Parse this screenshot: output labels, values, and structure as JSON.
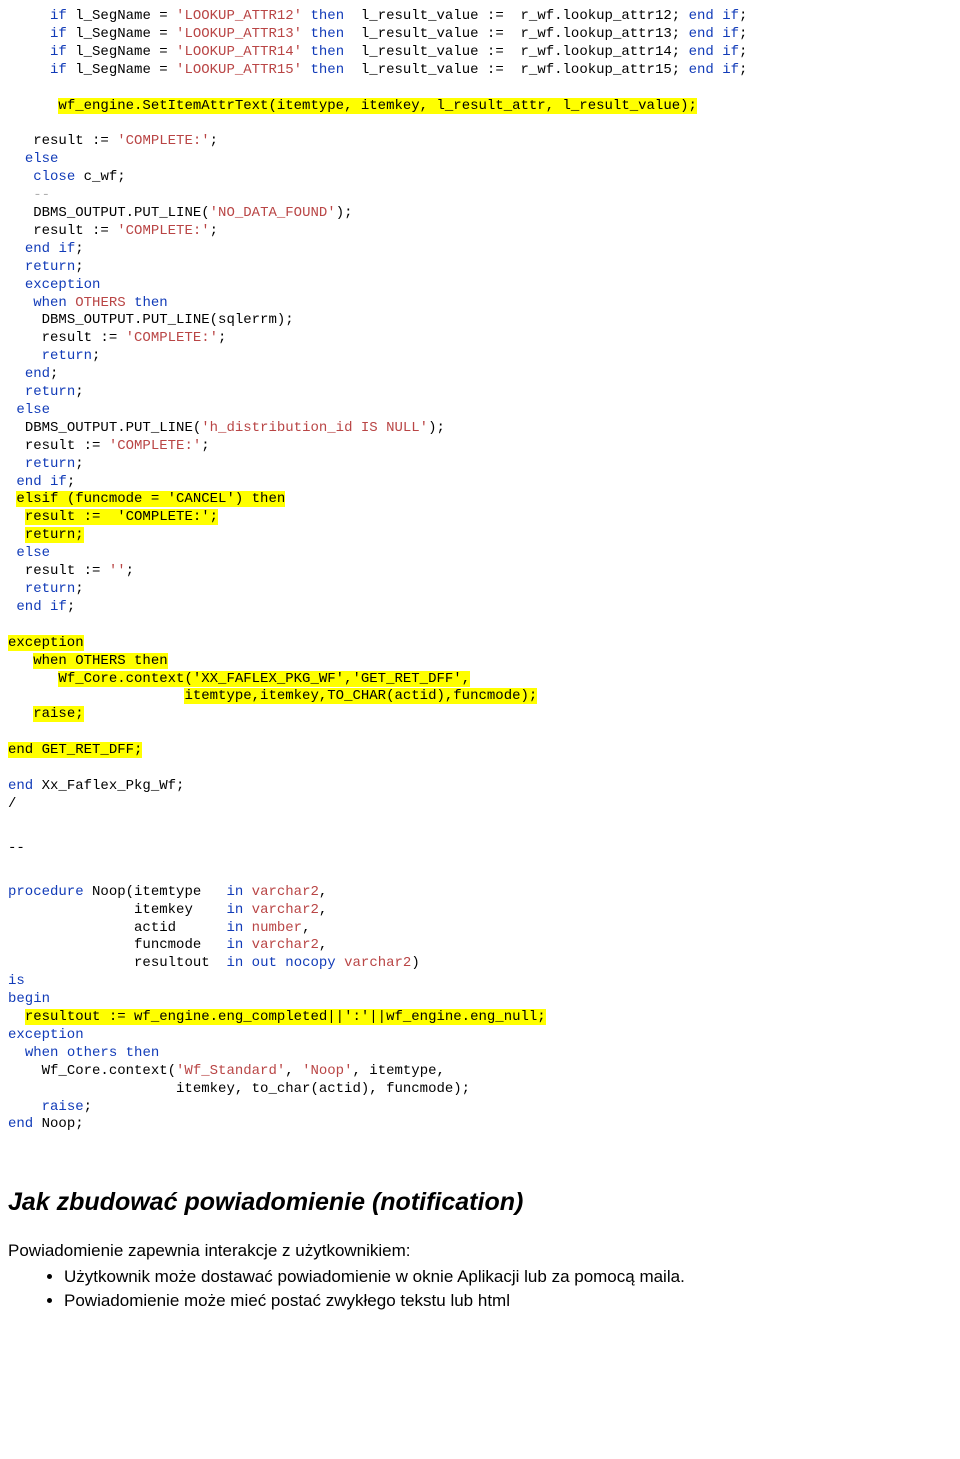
{
  "code1": [
    {
      "indent": "     ",
      "segments": [
        {
          "t": "if",
          "c": "kw"
        },
        {
          "t": " l_SegName = "
        },
        {
          "t": "'LOOKUP_ATTR12'",
          "c": "str"
        },
        {
          "t": " "
        },
        {
          "t": "then",
          "c": "kw"
        },
        {
          "t": "  l_result_value :=  r_wf.lookup_attr12; "
        },
        {
          "t": "end",
          "c": "kw"
        },
        {
          "t": " "
        },
        {
          "t": "if",
          "c": "kw"
        },
        {
          "t": ";"
        }
      ]
    },
    {
      "indent": "     ",
      "segments": [
        {
          "t": "if",
          "c": "kw"
        },
        {
          "t": " l_SegName = "
        },
        {
          "t": "'LOOKUP_ATTR13'",
          "c": "str"
        },
        {
          "t": " "
        },
        {
          "t": "then",
          "c": "kw"
        },
        {
          "t": "  l_result_value :=  r_wf.lookup_attr13; "
        },
        {
          "t": "end",
          "c": "kw"
        },
        {
          "t": " "
        },
        {
          "t": "if",
          "c": "kw"
        },
        {
          "t": ";"
        }
      ]
    },
    {
      "indent": "     ",
      "segments": [
        {
          "t": "if",
          "c": "kw"
        },
        {
          "t": " l_SegName = "
        },
        {
          "t": "'LOOKUP_ATTR14'",
          "c": "str"
        },
        {
          "t": " "
        },
        {
          "t": "then",
          "c": "kw"
        },
        {
          "t": "  l_result_value :=  r_wf.lookup_attr14; "
        },
        {
          "t": "end",
          "c": "kw"
        },
        {
          "t": " "
        },
        {
          "t": "if",
          "c": "kw"
        },
        {
          "t": ";"
        }
      ]
    },
    {
      "indent": "     ",
      "segments": [
        {
          "t": "if",
          "c": "kw"
        },
        {
          "t": " l_SegName = "
        },
        {
          "t": "'LOOKUP_ATTR15'",
          "c": "str"
        },
        {
          "t": " "
        },
        {
          "t": "then",
          "c": "kw"
        },
        {
          "t": "  l_result_value :=  r_wf.lookup_attr15; "
        },
        {
          "t": "end",
          "c": "kw"
        },
        {
          "t": " "
        },
        {
          "t": "if",
          "c": "kw"
        },
        {
          "t": ";"
        }
      ]
    },
    {
      "indent": "",
      "segments": [
        {
          "t": " "
        }
      ]
    },
    {
      "indent": "      ",
      "segments": [
        {
          "t": "wf_engine.SetItemAttrText(itemtype, itemkey, l_result_attr, l_result_value);",
          "c": "hl"
        }
      ]
    },
    {
      "indent": "",
      "segments": [
        {
          "t": " "
        }
      ]
    },
    {
      "indent": "   ",
      "segments": [
        {
          "t": "result := "
        },
        {
          "t": "'COMPLETE:'",
          "c": "str"
        },
        {
          "t": ";"
        }
      ]
    },
    {
      "indent": "  ",
      "segments": [
        {
          "t": "else",
          "c": "kw"
        }
      ]
    },
    {
      "indent": "   ",
      "segments": [
        {
          "t": "close",
          "c": "kw"
        },
        {
          "t": " c_wf;"
        }
      ]
    },
    {
      "indent": "   ",
      "segments": [
        {
          "t": "--",
          "c": "gray"
        }
      ]
    },
    {
      "indent": "   ",
      "segments": [
        {
          "t": "DBMS_OUTPUT.PUT_LINE("
        },
        {
          "t": "'NO_DATA_FOUND'",
          "c": "str"
        },
        {
          "t": ");"
        }
      ]
    },
    {
      "indent": "   ",
      "segments": [
        {
          "t": "result := "
        },
        {
          "t": "'COMPLETE:'",
          "c": "str"
        },
        {
          "t": ";"
        }
      ]
    },
    {
      "indent": "  ",
      "segments": [
        {
          "t": "end",
          "c": "kw"
        },
        {
          "t": " "
        },
        {
          "t": "if",
          "c": "kw"
        },
        {
          "t": ";"
        }
      ]
    },
    {
      "indent": "  ",
      "segments": [
        {
          "t": "return",
          "c": "kw"
        },
        {
          "t": ";"
        }
      ]
    },
    {
      "indent": "  ",
      "segments": [
        {
          "t": "exception",
          "c": "kw"
        }
      ]
    },
    {
      "indent": "   ",
      "segments": [
        {
          "t": "when",
          "c": "kw"
        },
        {
          "t": " "
        },
        {
          "t": "OTHERS",
          "c": "str"
        },
        {
          "t": " "
        },
        {
          "t": "then",
          "c": "kw"
        }
      ]
    },
    {
      "indent": "    ",
      "segments": [
        {
          "t": "DBMS_OUTPUT.PUT_LINE(sqlerrm);"
        }
      ]
    },
    {
      "indent": "    ",
      "segments": [
        {
          "t": "result := "
        },
        {
          "t": "'COMPLETE:'",
          "c": "str"
        },
        {
          "t": ";"
        }
      ]
    },
    {
      "indent": "    ",
      "segments": [
        {
          "t": "return",
          "c": "kw"
        },
        {
          "t": ";"
        }
      ]
    },
    {
      "indent": "  ",
      "segments": [
        {
          "t": "end",
          "c": "kw"
        },
        {
          "t": ";"
        }
      ]
    },
    {
      "indent": "  ",
      "segments": [
        {
          "t": "return",
          "c": "kw"
        },
        {
          "t": ";"
        }
      ]
    },
    {
      "indent": " ",
      "segments": [
        {
          "t": "else",
          "c": "kw"
        }
      ]
    },
    {
      "indent": "  ",
      "segments": [
        {
          "t": "DBMS_OUTPUT.PUT_LINE("
        },
        {
          "t": "'h_distribution_id IS NULL'",
          "c": "str"
        },
        {
          "t": ");"
        }
      ]
    },
    {
      "indent": "  ",
      "segments": [
        {
          "t": "result := "
        },
        {
          "t": "'COMPLETE:'",
          "c": "str"
        },
        {
          "t": ";"
        }
      ]
    },
    {
      "indent": "  ",
      "segments": [
        {
          "t": "return",
          "c": "kw"
        },
        {
          "t": ";"
        }
      ]
    },
    {
      "indent": " ",
      "segments": [
        {
          "t": "end",
          "c": "kw"
        },
        {
          "t": " "
        },
        {
          "t": "if",
          "c": "kw"
        },
        {
          "t": ";"
        }
      ]
    },
    {
      "indent": " ",
      "segments": [
        {
          "t": "elsif (funcmode = 'CANCEL') then",
          "c": "hl"
        }
      ]
    },
    {
      "indent": "  ",
      "segments": [
        {
          "t": "result :=  'COMPLETE:';",
          "c": "hl"
        }
      ]
    },
    {
      "indent": "  ",
      "segments": [
        {
          "t": "return;",
          "c": "hl"
        }
      ]
    },
    {
      "indent": " ",
      "segments": [
        {
          "t": "else",
          "c": "kw"
        }
      ]
    },
    {
      "indent": "  ",
      "segments": [
        {
          "t": "result := "
        },
        {
          "t": "''",
          "c": "str"
        },
        {
          "t": ";"
        }
      ]
    },
    {
      "indent": "  ",
      "segments": [
        {
          "t": "return",
          "c": "kw"
        },
        {
          "t": ";"
        }
      ]
    },
    {
      "indent": " ",
      "segments": [
        {
          "t": "end",
          "c": "kw"
        },
        {
          "t": " "
        },
        {
          "t": "if",
          "c": "kw"
        },
        {
          "t": ";"
        }
      ]
    },
    {
      "indent": "",
      "segments": [
        {
          "t": " "
        }
      ]
    },
    {
      "indent": "",
      "segments": [
        {
          "t": "exception",
          "c": "hl"
        }
      ]
    },
    {
      "indent": "   ",
      "segments": [
        {
          "t": "when OTHERS then",
          "c": "hl"
        }
      ]
    },
    {
      "indent": "      ",
      "segments": [
        {
          "t": "Wf_Core.context('XX_FAFLEX_PKG_WF','GET_RET_DFF',",
          "c": "hl"
        }
      ]
    },
    {
      "indent": "                     ",
      "segments": [
        {
          "t": "itemtype,itemkey,TO_CHAR(actid),funcmode);",
          "c": "hl"
        }
      ]
    },
    {
      "indent": "   ",
      "segments": [
        {
          "t": "raise;",
          "c": "hl"
        }
      ]
    },
    {
      "indent": "",
      "segments": [
        {
          "t": " "
        }
      ]
    },
    {
      "indent": "",
      "segments": [
        {
          "t": "end GET_RET_DFF;",
          "c": "hl"
        }
      ]
    },
    {
      "indent": "",
      "segments": [
        {
          "t": " "
        }
      ]
    },
    {
      "indent": "",
      "segments": [
        {
          "t": "end",
          "c": "kw"
        },
        {
          "t": " Xx_Faflex_Pkg_Wf;"
        }
      ]
    },
    {
      "indent": "",
      "segments": [
        {
          "t": "/"
        }
      ]
    }
  ],
  "separator": "--",
  "code2": [
    {
      "indent": "",
      "segments": [
        {
          "t": "procedure",
          "c": "kw"
        },
        {
          "t": " Noop(itemtype   "
        },
        {
          "t": "in",
          "c": "kw"
        },
        {
          "t": " "
        },
        {
          "t": "varchar2",
          "c": "str"
        },
        {
          "t": ","
        }
      ]
    },
    {
      "indent": "               ",
      "segments": [
        {
          "t": "itemkey    "
        },
        {
          "t": "in",
          "c": "kw"
        },
        {
          "t": " "
        },
        {
          "t": "varchar2",
          "c": "str"
        },
        {
          "t": ","
        }
      ]
    },
    {
      "indent": "               ",
      "segments": [
        {
          "t": "actid      "
        },
        {
          "t": "in",
          "c": "kw"
        },
        {
          "t": " "
        },
        {
          "t": "number",
          "c": "str"
        },
        {
          "t": ","
        }
      ]
    },
    {
      "indent": "               ",
      "segments": [
        {
          "t": "funcmode   "
        },
        {
          "t": "in",
          "c": "kw"
        },
        {
          "t": " "
        },
        {
          "t": "varchar2",
          "c": "str"
        },
        {
          "t": ","
        }
      ]
    },
    {
      "indent": "               ",
      "segments": [
        {
          "t": "resultout  "
        },
        {
          "t": "in",
          "c": "kw"
        },
        {
          "t": " "
        },
        {
          "t": "out",
          "c": "kw"
        },
        {
          "t": " "
        },
        {
          "t": "nocopy",
          "c": "kw"
        },
        {
          "t": " "
        },
        {
          "t": "varchar2",
          "c": "str"
        },
        {
          "t": ")"
        }
      ]
    },
    {
      "indent": "",
      "segments": [
        {
          "t": "is",
          "c": "kw"
        }
      ]
    },
    {
      "indent": "",
      "segments": [
        {
          "t": "begin",
          "c": "kw"
        }
      ]
    },
    {
      "indent": "  ",
      "segments": [
        {
          "t": "resultout := wf_engine.eng_completed||':'||wf_engine.eng_null;",
          "c": "hl"
        }
      ]
    },
    {
      "indent": "",
      "segments": [
        {
          "t": "exception",
          "c": "kw"
        }
      ]
    },
    {
      "indent": "  ",
      "segments": [
        {
          "t": "when",
          "c": "kw"
        },
        {
          "t": " "
        },
        {
          "t": "others",
          "c": "kw"
        },
        {
          "t": " "
        },
        {
          "t": "then",
          "c": "kw"
        }
      ]
    },
    {
      "indent": "    ",
      "segments": [
        {
          "t": "Wf_Core.context("
        },
        {
          "t": "'Wf_Standard'",
          "c": "str"
        },
        {
          "t": ", "
        },
        {
          "t": "'Noop'",
          "c": "str"
        },
        {
          "t": ", itemtype,"
        }
      ]
    },
    {
      "indent": "                    ",
      "segments": [
        {
          "t": "itemkey, to_char(actid), funcmode);"
        }
      ]
    },
    {
      "indent": "    ",
      "segments": [
        {
          "t": "raise",
          "c": "kw"
        },
        {
          "t": ";"
        }
      ]
    },
    {
      "indent": "",
      "segments": [
        {
          "t": "end",
          "c": "kw"
        },
        {
          "t": " Noop;"
        }
      ]
    }
  ],
  "heading": "Jak zbudować powiadomienie (notification)",
  "para_intro": "Powiadomienie zapewnia interakcje z użytkownikiem:",
  "bullets": [
    "Użytkownik może dostawać powiadomienie w oknie Aplikacji lub za pomocą maila.",
    "Powiadomienie może mieć postać zwykłego tekstu lub html"
  ]
}
